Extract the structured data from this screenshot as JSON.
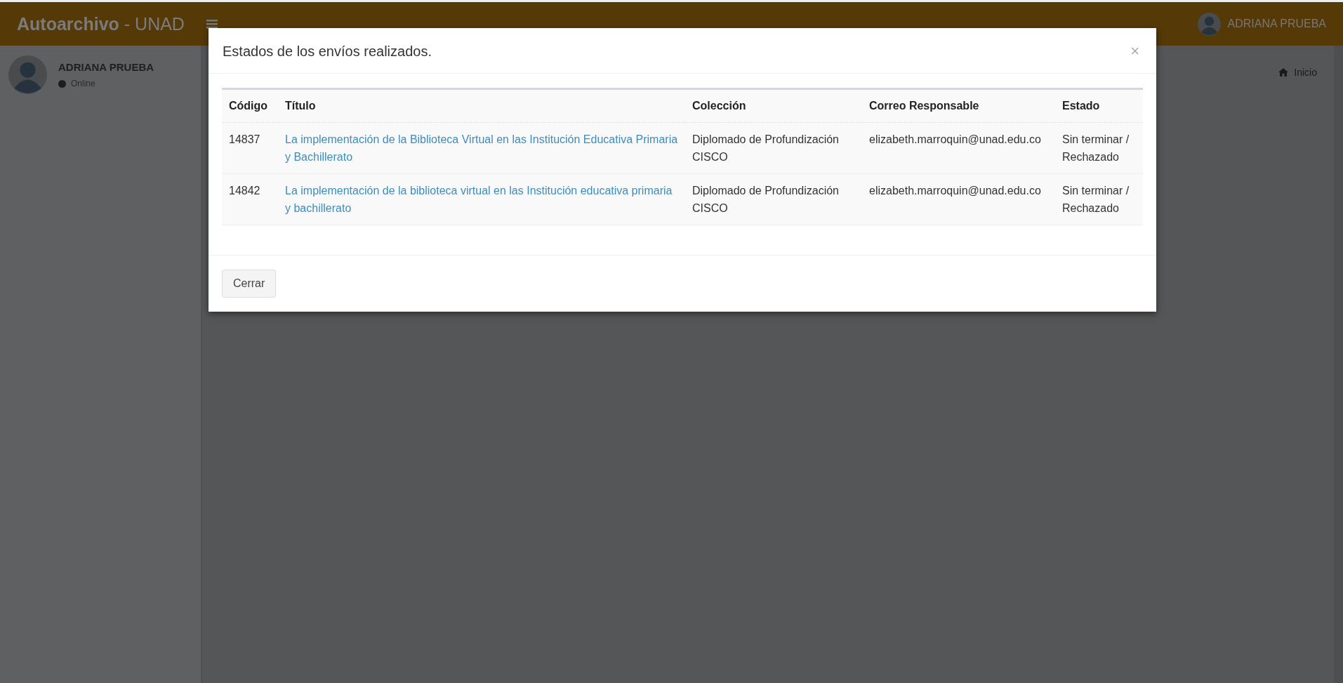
{
  "header": {
    "logo_bold": "Autoarchivo",
    "logo_rest": " - UNAD",
    "user_name": "ADRIANA PRUEBA"
  },
  "sidebar": {
    "user_name": "ADRIANA PRUEBA",
    "status": "Online"
  },
  "breadcrumb": {
    "label": "Inicio"
  },
  "modal": {
    "title": "Estados de los envíos realizados.",
    "close": "×",
    "table": {
      "columns": [
        "Código",
        "Título",
        "Colección",
        "Correo Responsable",
        "Estado"
      ],
      "rows": [
        {
          "code": "14837",
          "title": "La implementación de la Biblioteca Virtual en las Institución Educativa Primaria y Bachillerato",
          "collection": "Diplomado de Profundización CISCO",
          "email": "elizabeth.marroquin@unad.edu.co",
          "status": "Sin terminar / Rechazado"
        },
        {
          "code": "14842",
          "title": "La implementación de la biblioteca virtual en las Institución educativa primaria y bachillerato",
          "collection": "Diplomado de Profundización CISCO",
          "email": "elizabeth.marroquin@unad.edu.co",
          "status": "Sin terminar / Rechazado"
        }
      ]
    },
    "buttons": [
      "Cerrar"
    ]
  }
}
